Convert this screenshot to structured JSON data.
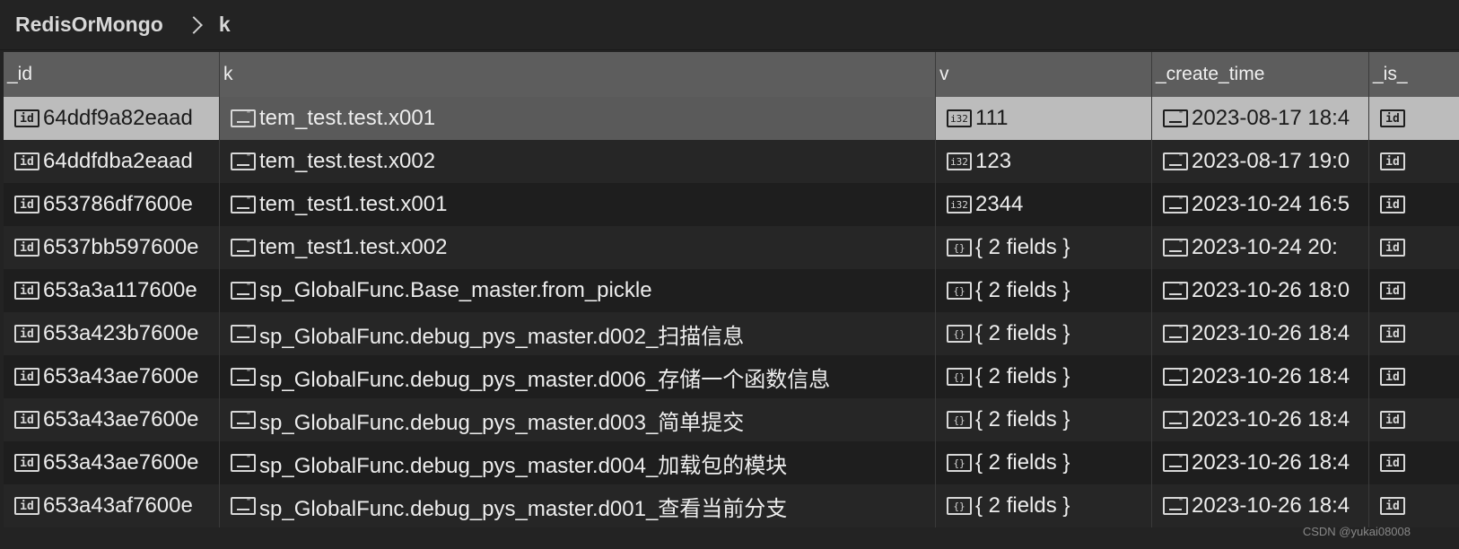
{
  "breadcrumb": {
    "root": "RedisOrMongo",
    "current": "k"
  },
  "columns": [
    {
      "key": "_id",
      "label": "_id"
    },
    {
      "key": "k",
      "label": "k"
    },
    {
      "key": "v",
      "label": "v"
    },
    {
      "key": "create_time",
      "label": "_create_time"
    },
    {
      "key": "is",
      "label": "_is_"
    }
  ],
  "rows": [
    {
      "id": "64ddf9a82eaad",
      "k": "tem_test.test.x001",
      "v_type": "int",
      "v": "111",
      "create_time": "2023-08-17 18:4",
      "selected": true
    },
    {
      "id": "64ddfdba2eaad",
      "k": "tem_test.test.x002",
      "v_type": "int",
      "v": "123",
      "create_time": "2023-08-17 19:0",
      "selected": false
    },
    {
      "id": "653786df7600e",
      "k": "tem_test1.test.x001",
      "v_type": "int",
      "v": "2344",
      "create_time": "2023-10-24 16:5",
      "selected": false
    },
    {
      "id": "6537bb597600e",
      "k": "tem_test1.test.x002",
      "v_type": "object",
      "v": "{ 2 fields }",
      "create_time": "2023-10-24 20:",
      "selected": false
    },
    {
      "id": "653a3a117600e",
      "k": "sp_GlobalFunc.Base_master.from_pickle",
      "v_type": "object",
      "v": "{ 2 fields }",
      "create_time": "2023-10-26 18:0",
      "selected": false
    },
    {
      "id": "653a423b7600e",
      "k": "sp_GlobalFunc.debug_pys_master.d002_扫描信息",
      "v_type": "object",
      "v": "{ 2 fields }",
      "create_time": "2023-10-26 18:4",
      "selected": false
    },
    {
      "id": "653a43ae7600e",
      "k": "sp_GlobalFunc.debug_pys_master.d006_存储一个函数信息",
      "v_type": "object",
      "v": "{ 2 fields }",
      "create_time": "2023-10-26 18:4",
      "selected": false
    },
    {
      "id": "653a43ae7600e",
      "k": "sp_GlobalFunc.debug_pys_master.d003_简单提交",
      "v_type": "object",
      "v": "{ 2 fields }",
      "create_time": "2023-10-26 18:4",
      "selected": false
    },
    {
      "id": "653a43ae7600e",
      "k": "sp_GlobalFunc.debug_pys_master.d004_加载包的模块",
      "v_type": "object",
      "v": "{ 2 fields }",
      "create_time": "2023-10-26 18:4",
      "selected": false
    },
    {
      "id": "653a43af7600e",
      "k": "sp_GlobalFunc.debug_pys_master.d001_查看当前分支",
      "v_type": "object",
      "v": "{ 2 fields }",
      "create_time": "2023-10-26 18:4",
      "selected": false
    }
  ],
  "icons": {
    "id": "id-icon",
    "string": "string-icon",
    "int": "int32-icon",
    "object": "object-icon",
    "date": "date-icon"
  },
  "icon_glyphs": {
    "id": "id",
    "int": "i32",
    "object": "{}"
  },
  "watermark": "CSDN @yukai08008"
}
